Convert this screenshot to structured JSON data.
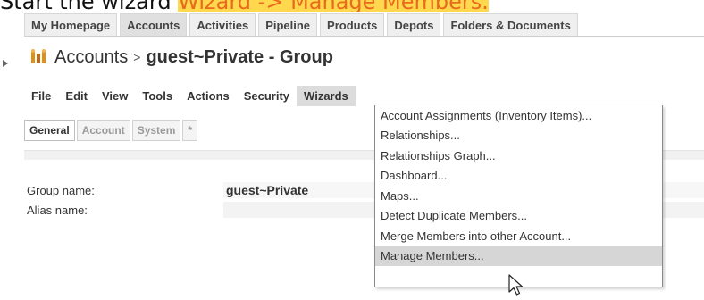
{
  "caption": {
    "prefix": "Start the wizard ",
    "highlight": "Wizard -> Manage Members."
  },
  "top_tabs": [
    {
      "label": "My Homepage",
      "active": false
    },
    {
      "label": "Accounts",
      "active": true
    },
    {
      "label": "Activities",
      "active": false
    },
    {
      "label": "Pipeline",
      "active": false
    },
    {
      "label": "Products",
      "active": false
    },
    {
      "label": "Depots",
      "active": false
    },
    {
      "label": "Folders & Documents",
      "active": false
    }
  ],
  "title": {
    "crumb": "Accounts",
    "separator": ">",
    "name": "guest~Private - Group"
  },
  "menubar": {
    "items": [
      "File",
      "Edit",
      "View",
      "Tools",
      "Actions",
      "Security",
      "Wizards"
    ],
    "open_item": "Wizards"
  },
  "subtabs": [
    {
      "label": "General",
      "active": true
    },
    {
      "label": "Account",
      "active": false
    },
    {
      "label": "System",
      "active": false
    },
    {
      "label": "*",
      "active": false
    }
  ],
  "fields": {
    "group_name_label": "Group name:",
    "group_name_value": "guest~Private",
    "alias_name_label": "Alias name:",
    "alias_name_value": ""
  },
  "wizards_menu": {
    "items": [
      "Account Assignments (Inventory Items)...",
      "Relationships...",
      "Relationships Graph...",
      "Dashboard...",
      "Maps...",
      "Detect Duplicate Members...",
      "Merge Members into other Account...",
      "Manage Members..."
    ],
    "hovered": "Manage Members..."
  },
  "colors": {
    "highlight_bg": "#ffd84d",
    "highlight_text": "#e86a1c",
    "title_icon": "#e0901a"
  }
}
